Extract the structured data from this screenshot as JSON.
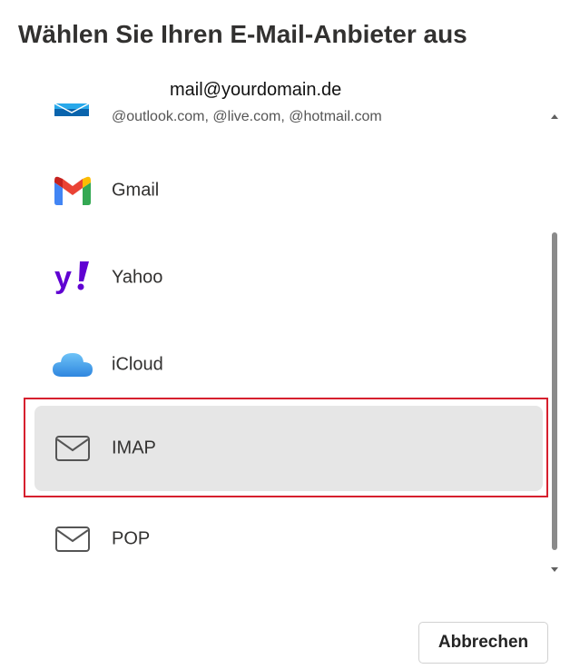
{
  "dialog": {
    "title": "Wählen Sie Ihren E-Mail-Anbieter aus",
    "cancel_label": "Abbrechen"
  },
  "providers": [
    {
      "id": "outlook",
      "label": "mail@yourdomain.de",
      "sublabel": "@outlook.com, @live.com, @hotmail.com",
      "icon": "outlook-icon"
    },
    {
      "id": "gmail",
      "label": "Gmail",
      "icon": "gmail-icon"
    },
    {
      "id": "yahoo",
      "label": "Yahoo",
      "icon": "yahoo-icon"
    },
    {
      "id": "icloud",
      "label": "iCloud",
      "icon": "icloud-icon"
    },
    {
      "id": "imap",
      "label": "IMAP",
      "icon": "envelope-icon",
      "selected": true
    },
    {
      "id": "pop",
      "label": "POP",
      "icon": "envelope-icon"
    }
  ],
  "colors": {
    "highlight": "#d6202e",
    "selected_bg": "#e6e6e6",
    "yahoo_purple": "#6001d2",
    "icloud_blue": "#3d9be9"
  }
}
